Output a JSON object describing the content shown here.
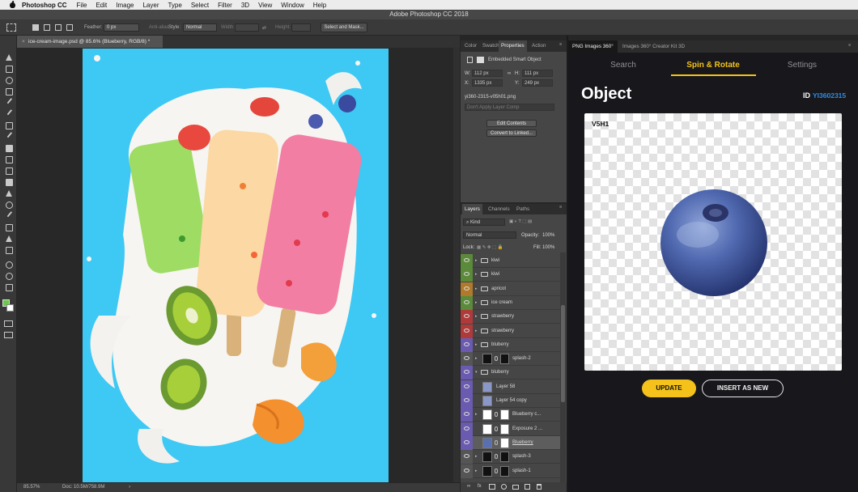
{
  "menubar": {
    "app_name": "Photoshop CC",
    "items": [
      "File",
      "Edit",
      "Image",
      "Layer",
      "Type",
      "Select",
      "Filter",
      "3D",
      "View",
      "Window",
      "Help"
    ]
  },
  "window_title": "Adobe Photoshop CC 2018",
  "options_bar": {
    "feather_label": "Feather:",
    "feather_value": "0 px",
    "anti_alias_label": "Anti-alias",
    "style_label": "Style:",
    "style_value": "Normal",
    "width_label": "Width:",
    "height_label": "Height:",
    "select_mask_label": "Select and Mask..."
  },
  "document": {
    "tab_title": "ice-cream-image.psd @ 85.6% (Blueberry, RGB/8) *",
    "zoom": "85.57%",
    "doc_size": "Doc: 10.5M/758.9M"
  },
  "properties_panel": {
    "tabs": [
      "Color",
      "Swatch",
      "Properties",
      "Action"
    ],
    "active_tab": "Properties",
    "object_type": "Embedded Smart Object",
    "w_label": "W:",
    "w_value": "112 px",
    "h_label": "H:",
    "h_value": "111 px",
    "x_label": "X:",
    "x_value": "1335 px",
    "y_label": "Y:",
    "y_value": "249 px",
    "filename": "yi360-2315-v05h01.png",
    "layer_comp_placeholder": "Don't Apply Layer Comp",
    "edit_contents": "Edit Contents",
    "convert_linked": "Convert to Linked..."
  },
  "layers_panel": {
    "tabs": [
      "Layers",
      "Channels",
      "Paths"
    ],
    "active_tab": "Layers",
    "filter_kind": "Kind",
    "blend_mode": "Normal",
    "opacity_label": "Opacity:",
    "opacity_value": "100%",
    "lock_label": "Lock:",
    "fill_label": "Fill:",
    "fill_value": "100%",
    "layers": [
      {
        "name": "kiwi",
        "color": "#5a8a3a",
        "kind": "group"
      },
      {
        "name": "kiwi",
        "color": "#5a8a3a",
        "kind": "group"
      },
      {
        "name": "apricot",
        "color": "#b07a2a",
        "kind": "group"
      },
      {
        "name": "ice cream",
        "color": "#5a8a3a",
        "kind": "group"
      },
      {
        "name": "strawberry",
        "color": "#b03a3a",
        "kind": "group"
      },
      {
        "name": "strawberry",
        "color": "#b03a3a",
        "kind": "group"
      },
      {
        "name": "bluberry",
        "color": "#6a5ab0",
        "kind": "group"
      },
      {
        "name": "splash-2",
        "color": "#555555",
        "kind": "masked"
      },
      {
        "name": "bluberry",
        "color": "#6a5ab0",
        "kind": "group-open"
      },
      {
        "name": "Layer 58",
        "color": "#6a5ab0",
        "kind": "layer"
      },
      {
        "name": "Layer 54 copy",
        "color": "#6a5ab0",
        "kind": "layer"
      },
      {
        "name": "Blueberry c...",
        "color": "#6a5ab0",
        "kind": "masked"
      },
      {
        "name": "Exposure 2 ...",
        "color": "#6a5ab0",
        "kind": "adjustment"
      },
      {
        "name": "Blueberry",
        "color": "#6a5ab0",
        "kind": "selected"
      },
      {
        "name": "splash-3",
        "color": "#555555",
        "kind": "masked"
      },
      {
        "name": "splash-1",
        "color": "#555555",
        "kind": "masked"
      }
    ],
    "bottom_fx": "fx"
  },
  "plugin": {
    "tabs": [
      "PNG Images 360°",
      "Images 360° Creator Kit 3D"
    ],
    "active_tab": "PNG Images 360°",
    "nav": [
      "Search",
      "Spin & Rotate",
      "Settings"
    ],
    "active_nav": "Spin & Rotate",
    "heading": "Object",
    "id_label": "ID",
    "id_value": "YI3602315",
    "view_code": "V5H1",
    "update_label": "UPDATE",
    "insert_label": "INSERT AS NEW"
  },
  "colors": {
    "accent_yellow": "#f4c21a",
    "id_blue": "#2c8de8",
    "canvas_cyan": "#3ec8f4",
    "foreground": "#6bc84a",
    "background": "#ffffff"
  }
}
